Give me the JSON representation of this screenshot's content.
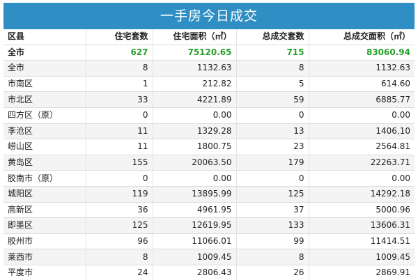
{
  "title": "一手房今日成交",
  "headers": [
    "区县",
    "住宅套数",
    "住宅面积（㎡）",
    "总成交套数",
    "总成交面积（㎡）"
  ],
  "total": [
    "全市",
    "627",
    "75120.65",
    "715",
    "83060.94"
  ],
  "rows": [
    [
      "全市",
      "8",
      "1132.63",
      "8",
      "1132.63"
    ],
    [
      "市南区",
      "1",
      "212.82",
      "5",
      "614.60"
    ],
    [
      "市北区",
      "33",
      "4221.89",
      "59",
      "6885.77"
    ],
    [
      "四方区（原）",
      "0",
      "0.00",
      "0",
      "0.00"
    ],
    [
      "李沧区",
      "11",
      "1329.28",
      "13",
      "1406.10"
    ],
    [
      "崂山区",
      "11",
      "1800.75",
      "23",
      "2564.81"
    ],
    [
      "黄岛区",
      "155",
      "20063.50",
      "179",
      "22263.71"
    ],
    [
      "胶南市（原）",
      "0",
      "0.00",
      "0",
      "0.00"
    ],
    [
      "城阳区",
      "119",
      "13895.99",
      "125",
      "14292.18"
    ],
    [
      "高新区",
      "36",
      "4961.95",
      "37",
      "5000.96"
    ],
    [
      "即墨区",
      "125",
      "12619.95",
      "133",
      "13606.31"
    ],
    [
      "胶州市",
      "96",
      "11066.01",
      "99",
      "11414.51"
    ],
    [
      "莱西市",
      "8",
      "1009.45",
      "8",
      "1009.45"
    ],
    [
      "平度市",
      "24",
      "2806.43",
      "26",
      "2869.91"
    ]
  ],
  "colors": {
    "title_bg": "#2f8fc4",
    "total_value": "#27a027",
    "row_alt": "#f4f4f4"
  }
}
